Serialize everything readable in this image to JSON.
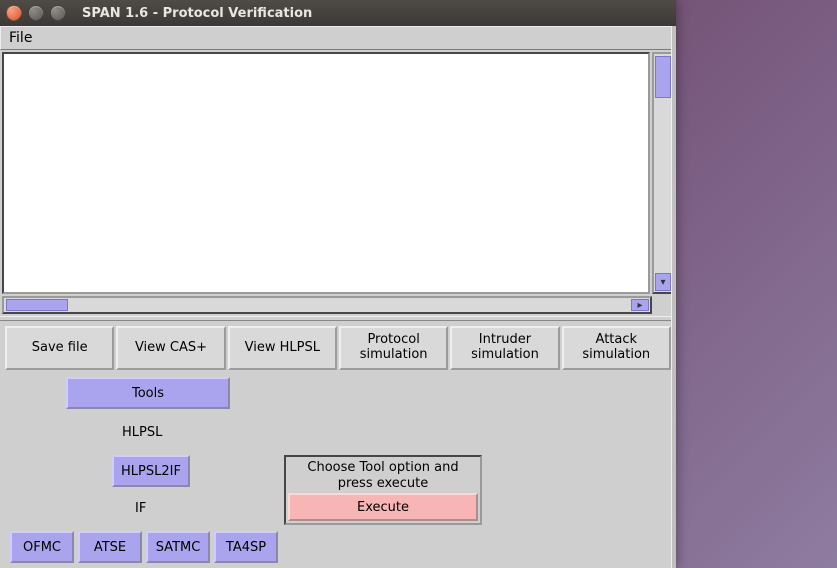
{
  "window": {
    "title": "SPAN 1.6 - Protocol Verification"
  },
  "menubar": {
    "file": "File"
  },
  "toolbar": {
    "save_file": "Save file",
    "view_cas": "View CAS+",
    "view_hlpsl": "View HLPSL",
    "protocol_sim": "Protocol\nsimulation",
    "intruder_sim": "Intruder\nsimulation",
    "attack_sim": "Attack\nsimulation"
  },
  "tools": {
    "header": "Tools",
    "hlpsl_label": "HLPSL",
    "hlpsl2if": "HLPSL2IF",
    "if_label": "IF",
    "ofmc": "OFMC",
    "atse": "ATSE",
    "satmc": "SATMC",
    "ta4sp": "TA4SP"
  },
  "execute": {
    "prompt": "Choose Tool option and press execute",
    "button": "Execute"
  }
}
